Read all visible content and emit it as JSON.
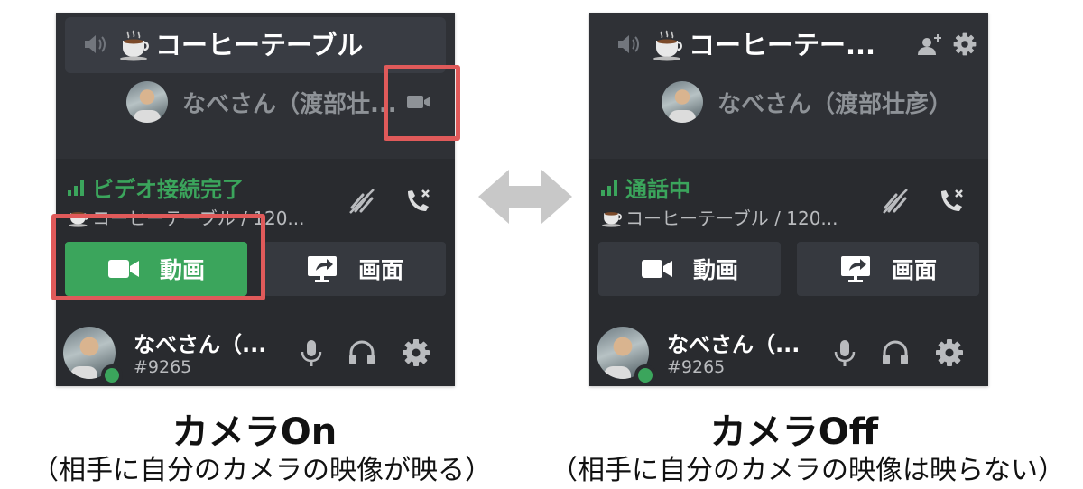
{
  "panels": {
    "left": {
      "channel_name": "コーヒーテーブル",
      "member_name": "なべさん（渡部壮...",
      "voice_status": "ビデオ接続完了",
      "voice_channel": "コーヒーテーブル / 120...",
      "video_label": "動画",
      "screen_label": "画面",
      "user_name": "なべさん（...",
      "user_tag": "#9265",
      "video_on": true
    },
    "right": {
      "channel_name": "コーヒーテー...",
      "member_name": "なべさん（渡部壮彦）",
      "voice_status": "通話中",
      "voice_channel": "コーヒーテーブル / 120...",
      "video_label": "動画",
      "screen_label": "画面",
      "user_name": "なべさん（...",
      "user_tag": "#9265",
      "video_on": false
    }
  },
  "captions": {
    "left_title": "カメラOn",
    "left_sub": "（相手に自分のカメラの映像が映る）",
    "right_title": "カメラOff",
    "right_sub": "（相手に自分のカメラの映像は映らない）"
  },
  "icons": {
    "speaker": "speaker-icon",
    "coffee": "coffee-icon",
    "camera": "camera-icon",
    "signal": "signal-bars-icon",
    "noise": "noise-suppression-icon",
    "disconnect": "disconnect-call-icon",
    "screen_share": "screen-share-icon",
    "mic": "microphone-icon",
    "headphones": "headphones-icon",
    "gear": "gear-icon",
    "add_user": "add-user-icon",
    "arrow": "double-arrow-icon"
  },
  "colors": {
    "panel_bg": "#2f3136",
    "panel_dark": "#292b2f",
    "button_bg": "#36393f",
    "green": "#3ba55c",
    "highlight": "#e05a5a",
    "muted_text": "#8e9297"
  }
}
